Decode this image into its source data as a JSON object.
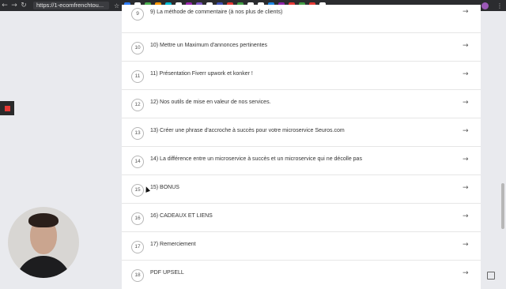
{
  "browser": {
    "url": "https://1-ecomfrenchtou...",
    "star_icon": "star-icon",
    "extension_colors": [
      "#2d7cf6",
      "#ffffff",
      "#4caf50",
      "#ff9800",
      "#00bcd4",
      "#ffffff",
      "#9c27b0",
      "#7e57c2",
      "#ffffff",
      "#3f51b5",
      "#e53935",
      "#43a047",
      "#ffffff",
      "#ffffff",
      "#1e88e5",
      "#8e24aa",
      "#e53935",
      "#43a047",
      "#e53935",
      "#ffffff"
    ],
    "profile_color": "#9b59b6"
  },
  "lessons": [
    {
      "num": "9",
      "title": "9) La méthode de commentaire (à nos plus de clients)"
    },
    {
      "num": "10",
      "title": "10) Mettre un Maximum d'annonces pertinentes"
    },
    {
      "num": "11",
      "title": "11) Présentation Fiverr upwork et konker !"
    },
    {
      "num": "12",
      "title": "12) Nos outils de mise en valeur de nos services."
    },
    {
      "num": "13",
      "title": "13) Créer une phrase d'accroche à succès pour votre microservice Seuros.com"
    },
    {
      "num": "14",
      "title": "14) La différence entre un microservice à succès et un microservice qui ne décolle pas"
    },
    {
      "num": "15",
      "title": "15) BONUS"
    },
    {
      "num": "16",
      "title": "16) CADEAUX ET LIENS"
    },
    {
      "num": "17",
      "title": "17) Remerciement"
    },
    {
      "num": "18",
      "title": "PDF UPSELL"
    }
  ],
  "arrow_glyph": "→",
  "colors": {
    "side_widget_accent": "#e53935"
  }
}
